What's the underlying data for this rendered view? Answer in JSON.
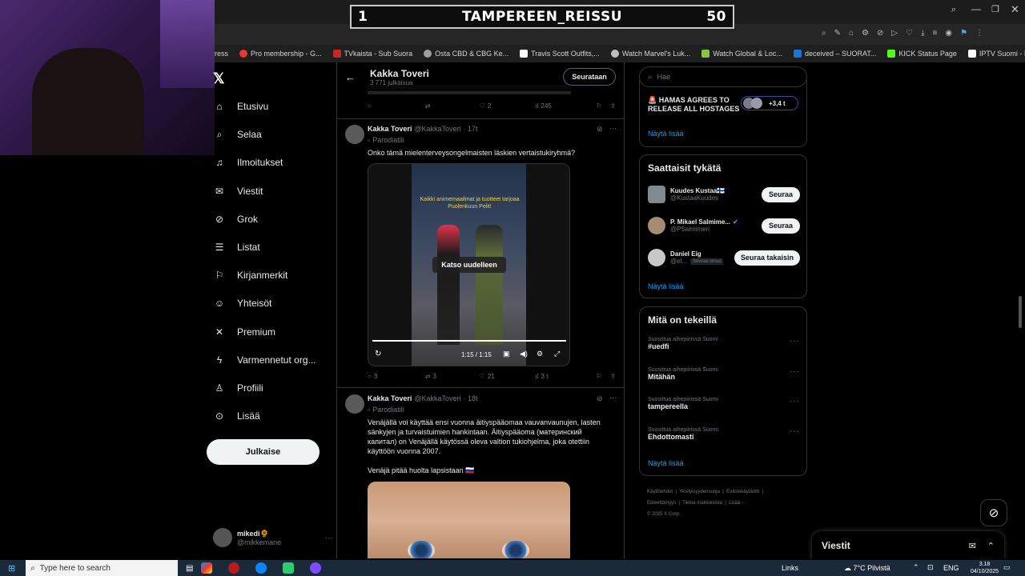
{
  "overlay": {
    "left": "1",
    "title": "TAMPEREEN_REISSU",
    "right": "50"
  },
  "bookmarks": [
    {
      "label": "ress",
      "color": "#444444"
    },
    {
      "label": "Pro membership - G...",
      "color": "#e53935"
    },
    {
      "label": "TVkaista - Sub Suora",
      "color": "#c62828"
    },
    {
      "label": "Osta CBD & CBG Ke...",
      "color": "#9e9e9e"
    },
    {
      "label": "Travis Scott Outfits,...",
      "color": "#ffffff"
    },
    {
      "label": "Watch Marvel's Luk...",
      "color": "#bdbdbd"
    },
    {
      "label": "Watch Global & Loc...",
      "color": "#8bc34a"
    },
    {
      "label": "deceived – SUORAT...",
      "color": "#1976d2"
    },
    {
      "label": "KICK Status Page",
      "color": "#53fc18"
    },
    {
      "label": "IPTV Suomi - IPTV v...",
      "color": "#ffffff"
    }
  ],
  "nav": {
    "items": [
      {
        "label": "Etusivu",
        "icon": "home-icon"
      },
      {
        "label": "Selaa",
        "icon": "search-icon"
      },
      {
        "label": "Ilmoitukset",
        "icon": "bell-icon"
      },
      {
        "label": "Viestit",
        "icon": "mail-icon"
      },
      {
        "label": "Grok",
        "icon": "grok-icon"
      },
      {
        "label": "Listat",
        "icon": "list-icon"
      },
      {
        "label": "Kirjanmerkit",
        "icon": "bookmark-icon"
      },
      {
        "label": "Yhteisöt",
        "icon": "communities-icon"
      },
      {
        "label": "Premium",
        "icon": "x-icon"
      },
      {
        "label": "Varmennetut org...",
        "icon": "lightning-icon"
      },
      {
        "label": "Profiili",
        "icon": "person-icon"
      },
      {
        "label": "Lisää",
        "icon": "more-circle-icon"
      }
    ],
    "post_label": "Julkaise",
    "account_name": "mikedi🌻",
    "account_handle": "@mikkemane",
    "account_more": "···"
  },
  "profile_header": {
    "name": "Kakka Toveri",
    "posts": "3 771 julkaisua",
    "follow_label": "Seurataan"
  },
  "prev_actions": {
    "reply": "",
    "retweet": "",
    "like": "2",
    "views": "245"
  },
  "tweets": [
    {
      "name": "Kakka Toveri",
      "handle": "@KakkaToveri",
      "time": "· 17t",
      "label": "Parodiatili",
      "text": "Onko tämä mielenterveysongelmaisten läskien vertaistukiryhmä?",
      "video": {
        "caption": "Kaikki animemaailmat ja tuotteet tarjoaa Puolenkuun Pelit!",
        "replay": "Katso uudelleen",
        "time": "1:15 / 1:15",
        "progress": 1.0
      },
      "actions": {
        "reply": "3",
        "retweet": "3",
        "like": "21",
        "views": "3 t"
      }
    },
    {
      "name": "Kakka Toveri",
      "handle": "@KakkaToveri",
      "time": "· 18t",
      "label": "Parodiatili",
      "text": "Venäjällä voi käyttää ensi vuonna äitiyspääomaa vauvanvaunujen, lasten sänkyjen ja turvaistuimien hankintaan. Äitiyspääoma (материнский капитал) on Venäjällä käytössä oleva valtion tukiohjelma, joka otettiin käyttöön vuonna 2007.",
      "text2": "Venäjä pitää huolta lapsistaan 🇷🇺"
    }
  ],
  "right": {
    "search_placeholder": "Hae",
    "trend_headline": "🚨 HAMAS AGREES TO RELEASE ALL HOSTAGES",
    "trend_count": "+3,4 t",
    "show_more": "Näytä lisää",
    "suggest_title": "Saattaisit tykätä",
    "suggestions": [
      {
        "name": "Kuudes Kustaa🇫🇮",
        "handle": "@KustaaKuudes",
        "button": "Seuraa",
        "badge": ""
      },
      {
        "name": "P. Mikael Salmime...",
        "handle": "@PSalmimeri",
        "button": "Seuraa",
        "badge": ""
      },
      {
        "name": "Daniel Eig",
        "handle": "@el...",
        "button": "Seuraa takaisin",
        "badge": "Seuraa sinua"
      }
    ],
    "happening_title": "Mitä on tekeillä",
    "trends": [
      {
        "context": "Suosittua aihepiirissä Suomi",
        "topic": "#uedfi"
      },
      {
        "context": "Suosittua aihepiirissä Suomi",
        "topic": "Mitähän"
      },
      {
        "context": "Suosittua aihepiirissä Suomi",
        "topic": "tampereella"
      },
      {
        "context": "Suosittua aihepiirissä Suomi",
        "topic": "Ehdottomasti"
      }
    ],
    "footer": [
      "Käyttöehdot",
      "Yksityisyydensuoja",
      "Evästekäytäntö",
      "Esteettömyys",
      "Tietoa mainoksista",
      "Lisää ···",
      "© 2025 X Corp."
    ]
  },
  "dm": {
    "title": "Viestit"
  },
  "taskbar": {
    "search_placeholder": "Type here to search",
    "links": "Links",
    "weather": "7°C  Pilvistä",
    "lang": "ENG",
    "time": "3.18",
    "date": "04/10/2025"
  }
}
